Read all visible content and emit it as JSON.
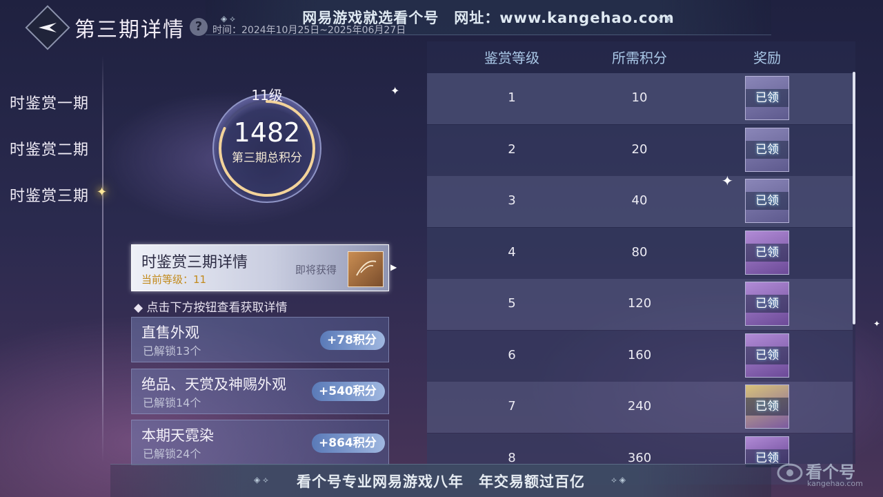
{
  "banner": {
    "top_text": "网易游戏就选看个号　网址：www.kangehao.com",
    "bottom_text": "看个号专业网易游戏八年　年交易额过百亿"
  },
  "header": {
    "title": "第三期详情",
    "help_symbol": "?",
    "time": "时间：2024年10月25日~2025年06月27日"
  },
  "sidebar": {
    "items": [
      {
        "label": "时鉴赏一期"
      },
      {
        "label": "时鉴赏二期"
      },
      {
        "label": "时鉴赏三期"
      }
    ],
    "active_index": 2
  },
  "score": {
    "level": "11级",
    "total": "1482",
    "caption": "第三期总积分",
    "ring_progress": 0.82
  },
  "detail": {
    "title": "时鉴赏三期详情",
    "current_level": "当前等级：11",
    "coming_soon": "即将获得"
  },
  "hint": "◆ 点击下方按钮查看获取详情",
  "sources": [
    {
      "title": "直售外观",
      "unlocked": "已解锁13个",
      "points": "+78积分"
    },
    {
      "title": "绝品、天赏及神赐外观",
      "unlocked": "已解锁14个",
      "points": "+540积分"
    },
    {
      "title": "本期天霓染",
      "unlocked": "已解锁24个",
      "points": "+864积分"
    }
  ],
  "table": {
    "headers": [
      "鉴赏等级",
      "所需积分",
      "奖励"
    ],
    "rows": [
      {
        "level": "1",
        "points": "10",
        "status": "已领",
        "style": "plain"
      },
      {
        "level": "2",
        "points": "20",
        "status": "已领",
        "style": "plain"
      },
      {
        "level": "3",
        "points": "40",
        "status": "已领",
        "style": "plain"
      },
      {
        "level": "4",
        "points": "80",
        "status": "已领",
        "style": "purple"
      },
      {
        "level": "5",
        "points": "120",
        "status": "已领",
        "style": "purple"
      },
      {
        "level": "6",
        "points": "160",
        "status": "已领",
        "style": "purple"
      },
      {
        "level": "7",
        "points": "240",
        "status": "已领",
        "style": "gold"
      },
      {
        "level": "8",
        "points": "360",
        "status": "已领",
        "style": "purple"
      }
    ]
  },
  "watermark": {
    "name": "看个号",
    "site": "kangehao.com"
  },
  "colors": {
    "accent_gold": "#ffd84a",
    "header_blue": "#a9c7e6",
    "points_pill": "#5a7ab8"
  }
}
